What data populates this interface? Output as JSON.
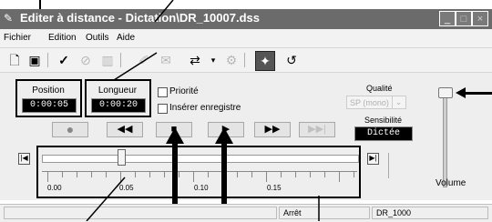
{
  "window": {
    "title": "Editer à distance - Dictation\\DR_10007.dss"
  },
  "menu": [
    "Fichier",
    "Edition",
    "Outils",
    "Aide"
  ],
  "position": {
    "label": "Position",
    "value": "0:00:05"
  },
  "length": {
    "label": "Longueur",
    "value": "0:00:20"
  },
  "options": {
    "priority_label": "Priorité",
    "insert_label": "Insérer enregistre"
  },
  "quality": {
    "label": "Qualité",
    "value": "SP (mono)"
  },
  "sensitivity": {
    "label": "Sensibilité",
    "value": "Dictée"
  },
  "volume": {
    "label": "Volume"
  },
  "timeline": {
    "ticks": [
      "0.00",
      "0.05",
      "0.10",
      "0.15"
    ],
    "position_fraction": 0.25
  },
  "status": {
    "state": "Arrêt",
    "file": "DR_1000"
  },
  "icons": {
    "new": "new-document-icon",
    "save": "save-icon",
    "check": "check-icon",
    "cancel": "cancel-icon",
    "book": "book-icon",
    "edit": "edit-icon",
    "attach": "attach-icon",
    "send": "send-icon",
    "settings": "settings-icon",
    "wizard": "wizard-icon",
    "undo": "undo-icon"
  }
}
